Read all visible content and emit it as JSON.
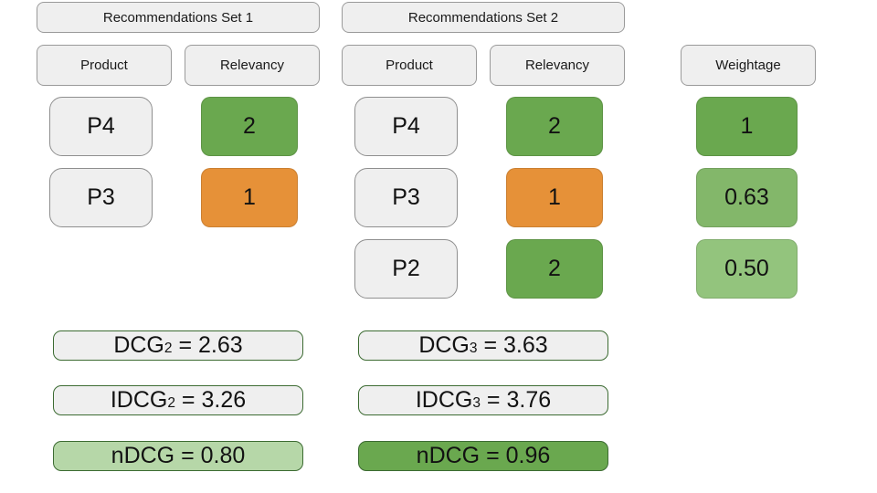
{
  "colors": {
    "panel_gray": "#efefef",
    "green_dark": "#6aa84f",
    "green_mid": "#83b76a",
    "green_light": "#93c47d",
    "green_pale": "#b6d7a8",
    "orange": "#e69138",
    "border_gray": "#9a9a9a",
    "border_green": "#3c6b32"
  },
  "sets": [
    {
      "title": "Recommendations Set 1",
      "columns": {
        "product": "Product",
        "relevancy": "Relevancy"
      },
      "rows": [
        {
          "product": "P4",
          "relevancy": "2",
          "relevancy_color": "#6aa84f"
        },
        {
          "product": "P3",
          "relevancy": "1",
          "relevancy_color": "#e69138"
        }
      ],
      "metrics": [
        {
          "label": "DCG",
          "subscript": "2",
          "value": "2.63",
          "fill": "#efefef"
        },
        {
          "label": "IDCG",
          "subscript": "2",
          "value": "3.26",
          "fill": "#efefef"
        },
        {
          "label": "nDCG",
          "subscript": "",
          "value": "0.80",
          "fill": "#b6d7a8"
        }
      ]
    },
    {
      "title": "Recommendations Set 2",
      "columns": {
        "product": "Product",
        "relevancy": "Relevancy"
      },
      "rows": [
        {
          "product": "P4",
          "relevancy": "2",
          "relevancy_color": "#6aa84f"
        },
        {
          "product": "P3",
          "relevancy": "1",
          "relevancy_color": "#e69138"
        },
        {
          "product": "P2",
          "relevancy": "2",
          "relevancy_color": "#6aa84f"
        }
      ],
      "metrics": [
        {
          "label": "DCG",
          "subscript": "3",
          "value": "3.63",
          "fill": "#efefef"
        },
        {
          "label": "IDCG",
          "subscript": "3",
          "value": "3.76",
          "fill": "#efefef"
        },
        {
          "label": "nDCG",
          "subscript": "",
          "value": "0.96",
          "fill": "#6aa84f"
        }
      ]
    }
  ],
  "weightage": {
    "header": "Weightage",
    "values": [
      {
        "value": "1",
        "fill": "#6aa84f"
      },
      {
        "value": "0.63",
        "fill": "#83b76a"
      },
      {
        "value": "0.50",
        "fill": "#93c47d"
      }
    ]
  }
}
